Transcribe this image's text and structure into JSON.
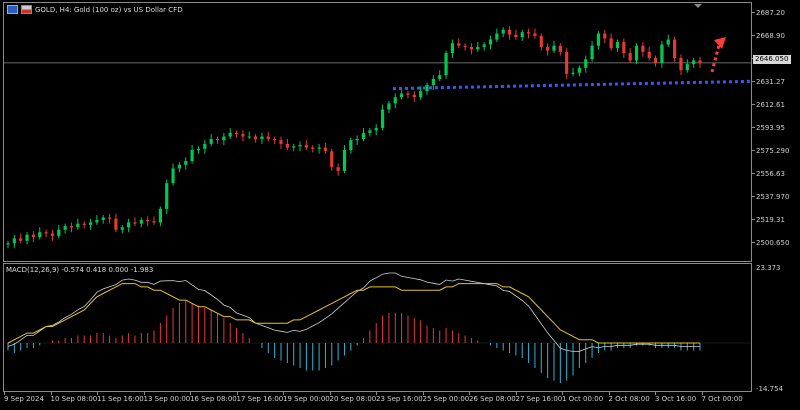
{
  "header": {
    "title": "GOLD, H4:  Gold (100 oz) vs US Dollar CFD"
  },
  "price_axis": {
    "labels": [
      "2687.20",
      "2668.90",
      "2649.930",
      "2631.27",
      "2612.61",
      "2593.95",
      "2575.290",
      "2556.63",
      "2537.970",
      "2519.31",
      "2500.650"
    ],
    "current_price": "2646.050"
  },
  "macd": {
    "label": "MACD(12,26,9) -0.574 0.418 0.000 -1.983",
    "axis_top": "23.373",
    "axis_bottom": "-14.754"
  },
  "time_axis": {
    "labels": [
      "9 Sep 2024",
      "10 Sep 08:00",
      "11 Sep 16:00",
      "13 Sep 00:00",
      "16 Sep 08:00",
      "17 Sep 16:00",
      "19 Sep 00:00",
      "20 Sep 08:00",
      "23 Sep 16:00",
      "25 Sep 00:00",
      "26 Sep 08:00",
      "27 Sep 16:00",
      "1 Oct 00:00",
      "2 Oct 08:00",
      "3 Oct 16:00",
      "7 Oct 00:00"
    ]
  },
  "colors": {
    "bull": "#00c853",
    "bear": "#e53935",
    "macd_pos": "#e53935",
    "macd_neg": "#29b6d6",
    "signal": "#e6c229",
    "macd_line": "#cfcfcf",
    "support_line": "#3a55ff",
    "arrow": "#ff3b3b"
  },
  "chart_data": {
    "type": "candlestick",
    "symbol": "GOLD",
    "timeframe": "H4",
    "ylim": [
      2487,
      2694
    ],
    "closes": [
      2499,
      2503,
      2501,
      2506,
      2504,
      2508,
      2507,
      2505,
      2510,
      2513,
      2512,
      2515,
      2514,
      2516,
      2518,
      2520,
      2519,
      2510,
      2512,
      2516,
      2515,
      2518,
      2517,
      2516,
      2527,
      2548,
      2560,
      2563,
      2566,
      2575,
      2576,
      2580,
      2584,
      2583,
      2586,
      2589,
      2588,
      2586,
      2586,
      2584,
      2586,
      2584,
      2583,
      2580,
      2577,
      2578,
      2579,
      2577,
      2576,
      2577,
      2574,
      2561,
      2558,
      2575,
      2583,
      2584,
      2589,
      2591,
      2593,
      2608,
      2613,
      2618,
      2621,
      2620,
      2618,
      2623,
      2628,
      2633,
      2636,
      2654,
      2662,
      2660,
      2659,
      2657,
      2659,
      2661,
      2665,
      2670,
      2673,
      2669,
      2667,
      2671,
      2670,
      2668,
      2659,
      2656,
      2660,
      2655,
      2637,
      2638,
      2642,
      2649,
      2660,
      2670,
      2666,
      2658,
      2663,
      2654,
      2648,
      2660,
      2655,
      2650,
      2646,
      2661,
      2665,
      2650,
      2640,
      2645,
      2648,
      2646
    ],
    "macd_hist": [
      -3,
      -4,
      -3,
      -2,
      -2,
      -1,
      0,
      1,
      1,
      2,
      2,
      3,
      3,
      3,
      4,
      4,
      3,
      2,
      3,
      4,
      3,
      4,
      4,
      5,
      8,
      11,
      14,
      16,
      17,
      16,
      15,
      14,
      13,
      12,
      10,
      8,
      6,
      4,
      2,
      0,
      -2,
      -4,
      -6,
      -7,
      -8,
      -9,
      -10,
      -11,
      -11,
      -11,
      -10,
      -9,
      -7,
      -5,
      -3,
      -1,
      2,
      5,
      8,
      11,
      12,
      12,
      12,
      11,
      10,
      9,
      7,
      6,
      5,
      6,
      5,
      4,
      3,
      2,
      1,
      0,
      -1,
      -2,
      -3,
      -4,
      -5,
      -6,
      -8,
      -10,
      -12,
      -14,
      -15,
      -16,
      -15,
      -13,
      -10,
      -8,
      -6,
      -4,
      -3,
      -3,
      -2,
      -2,
      -2,
      -1,
      -1,
      -1,
      -2,
      -2,
      -2,
      -2,
      -3,
      -3,
      -3,
      -3
    ],
    "signal_levels": [
      0,
      1,
      2,
      3,
      3,
      4,
      5,
      5,
      6,
      7,
      8,
      9,
      10,
      12,
      14,
      15,
      16,
      17,
      18,
      18,
      18,
      17,
      17,
      16,
      16,
      15,
      14,
      13,
      13,
      12,
      11,
      11,
      10,
      9,
      8,
      8,
      7,
      7,
      7,
      6,
      6,
      6,
      6,
      6,
      6,
      7,
      7,
      8,
      9,
      10,
      11,
      12,
      13,
      14,
      15,
      16,
      16,
      17,
      17,
      17,
      17,
      17,
      16,
      16,
      16,
      16,
      16,
      16,
      16,
      17,
      17,
      18,
      18,
      18,
      18,
      18,
      18,
      18,
      17,
      17,
      16,
      15,
      14,
      12,
      10,
      8,
      6,
      4,
      3,
      2,
      1,
      1,
      1,
      0,
      0,
      0,
      0,
      0,
      0,
      0,
      0,
      0,
      0,
      0,
      0,
      0,
      0,
      0,
      0,
      0
    ],
    "annotations": {
      "support_line": {
        "from_price": 2625,
        "to_price": 2631
      },
      "arrow": "up"
    }
  }
}
